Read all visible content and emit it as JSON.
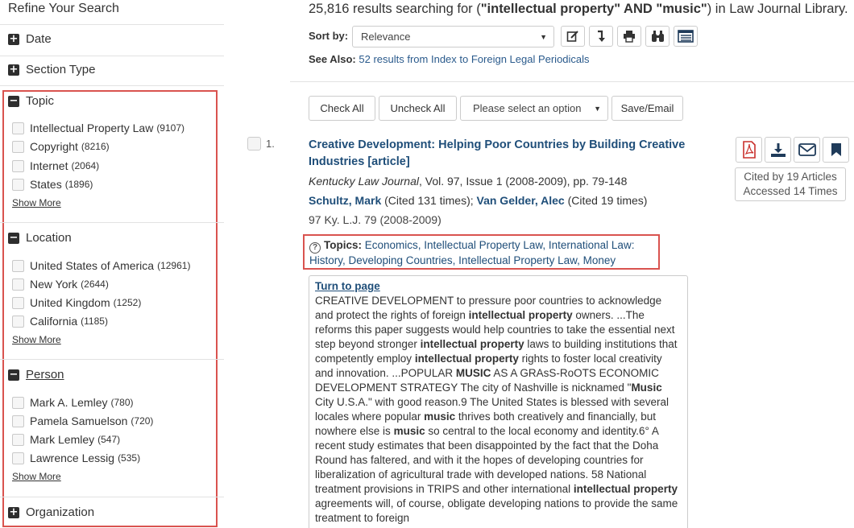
{
  "sidebar": {
    "title": "Refine Your Search",
    "facets": {
      "date": "Date",
      "section_type": "Section Type",
      "topic": "Topic",
      "location": "Location",
      "person": "Person",
      "organization": "Organization"
    },
    "topic_items": [
      {
        "label": "Intellectual Property Law",
        "count": "(9107)"
      },
      {
        "label": "Copyright",
        "count": "(8216)"
      },
      {
        "label": "Internet",
        "count": "(2064)"
      },
      {
        "label": "States",
        "count": "(1896)"
      }
    ],
    "location_items": [
      {
        "label": "United States of America",
        "count": "(12961)"
      },
      {
        "label": "New York",
        "count": "(2644)"
      },
      {
        "label": "United Kingdom",
        "count": "(1252)"
      },
      {
        "label": "California",
        "count": "(1185)"
      }
    ],
    "person_items": [
      {
        "label": "Mark A. Lemley",
        "count": "(780)"
      },
      {
        "label": "Pamela Samuelson",
        "count": "(720)"
      },
      {
        "label": "Mark Lemley",
        "count": "(547)"
      },
      {
        "label": "Lawrence Lessig",
        "count": "(535)"
      }
    ],
    "show_more": "Show More"
  },
  "header": {
    "results_prefix": "25,816 results searching for (",
    "term1": "\"intellectual property\"",
    "and": " AND ",
    "term2": "\"music\"",
    "results_suffix": ") in Law Journal Library.",
    "sort_label": "Sort by:",
    "sort_value": "Relevance",
    "see_also_label": "See Also:",
    "see_also_link": "52 results from Index to Foreign Legal Periodicals"
  },
  "toolbar": {
    "check_all": "Check All",
    "uncheck_all": "Uncheck All",
    "option_select": "Please select an option",
    "save_email": "Save/Email"
  },
  "result": {
    "number": "1.",
    "title": "Creative Development: Helping Poor Countries by Building Creative Industries [article]",
    "journal": "Kentucky Law Journal",
    "journal_details": ", Vol. 97, Issue 1 (2008-2009), pp. 79-148",
    "author1": "Schultz, Mark",
    "author1_cited": " (Cited 131 times); ",
    "author2": "Van Gelder, Alec",
    "author2_cited": " (Cited 19 times)",
    "citation": "97 Ky. L.J. 79 (2008-2009)",
    "topics_label": "Topics:",
    "topics": "Economics, Intellectual Property Law, International Law: History, Developing Countries, Intellectual Property Law, Money",
    "cited_by": "Cited by 19 Articles",
    "accessed": "Accessed 14 Times",
    "turn_to_page": "Turn to page",
    "snippet": [
      {
        "t": "CREATIVE DEVELOPMENT to pressure poor countries to acknowledge and protect the rights of foreign ",
        "b": false
      },
      {
        "t": "intellectual property",
        "b": true
      },
      {
        "t": " owners. ...The reforms this paper suggests would help countries to take the essential next step beyond stronger ",
        "b": false
      },
      {
        "t": "intellectual property",
        "b": true
      },
      {
        "t": " laws to building institutions that competently employ ",
        "b": false
      },
      {
        "t": "intellectual property",
        "b": true
      },
      {
        "t": " rights to foster local creativity and innovation. ...POPULAR ",
        "b": false
      },
      {
        "t": "MUSIC",
        "b": true
      },
      {
        "t": " AS A GRAsS-RoOTS ECONOMIC DEVELOPMENT STRATEGY The city of Nashville is nicknamed \"",
        "b": false
      },
      {
        "t": "Music",
        "b": true
      },
      {
        "t": " City U.S.A.\" with good reason.9 The United States is blessed with several locales where popular ",
        "b": false
      },
      {
        "t": "music",
        "b": true
      },
      {
        "t": " thrives both creatively and financially, but nowhere else is ",
        "b": false
      },
      {
        "t": "music",
        "b": true
      },
      {
        "t": " so central to the local economy and identity.6° A recent study estimates that been disappointed by the fact that the Doha Round has faltered, and with it the hopes of developing countries for liberalization of agricultural trade with developed nations. 58 National treatment provisions in TRIPS and other international ",
        "b": false
      },
      {
        "t": "intellectual property",
        "b": true
      },
      {
        "t": " agreements will, of course, obligate developing nations to provide the same treatment to foreign",
        "b": false
      }
    ]
  },
  "colors": {
    "highlight_border": "#d9534f",
    "link": "#1f4e79"
  }
}
